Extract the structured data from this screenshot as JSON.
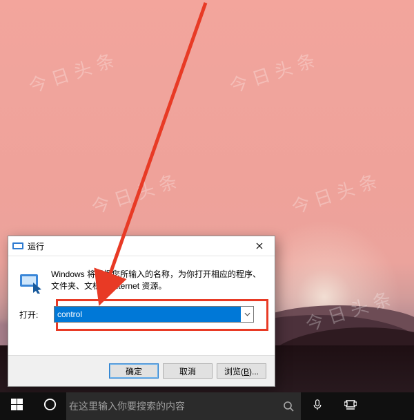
{
  "dialog": {
    "title": "运行",
    "description": "Windows 将根据您所输入的名称，为你打开相应的程序、文件夹、文档或 Internet 资源。",
    "open_label": "打开:",
    "input_value": "control",
    "buttons": {
      "ok": "确定",
      "cancel": "取消",
      "browse_prefix": "浏览(",
      "browse_hotkey": "B",
      "browse_suffix": ")..."
    }
  },
  "taskbar": {
    "search_placeholder": "在这里输入你要搜索的内容"
  },
  "watermark": "今日头条",
  "icons": {
    "title_icon": "run-dialog-icon",
    "close": "close-icon",
    "dropdown": "chevron-down-icon",
    "run_body": "run-command-icon",
    "start": "windows-logo-icon",
    "cortana": "cortana-circle-icon",
    "search": "search-icon",
    "mic": "microphone-icon",
    "taskview": "task-view-icon"
  }
}
